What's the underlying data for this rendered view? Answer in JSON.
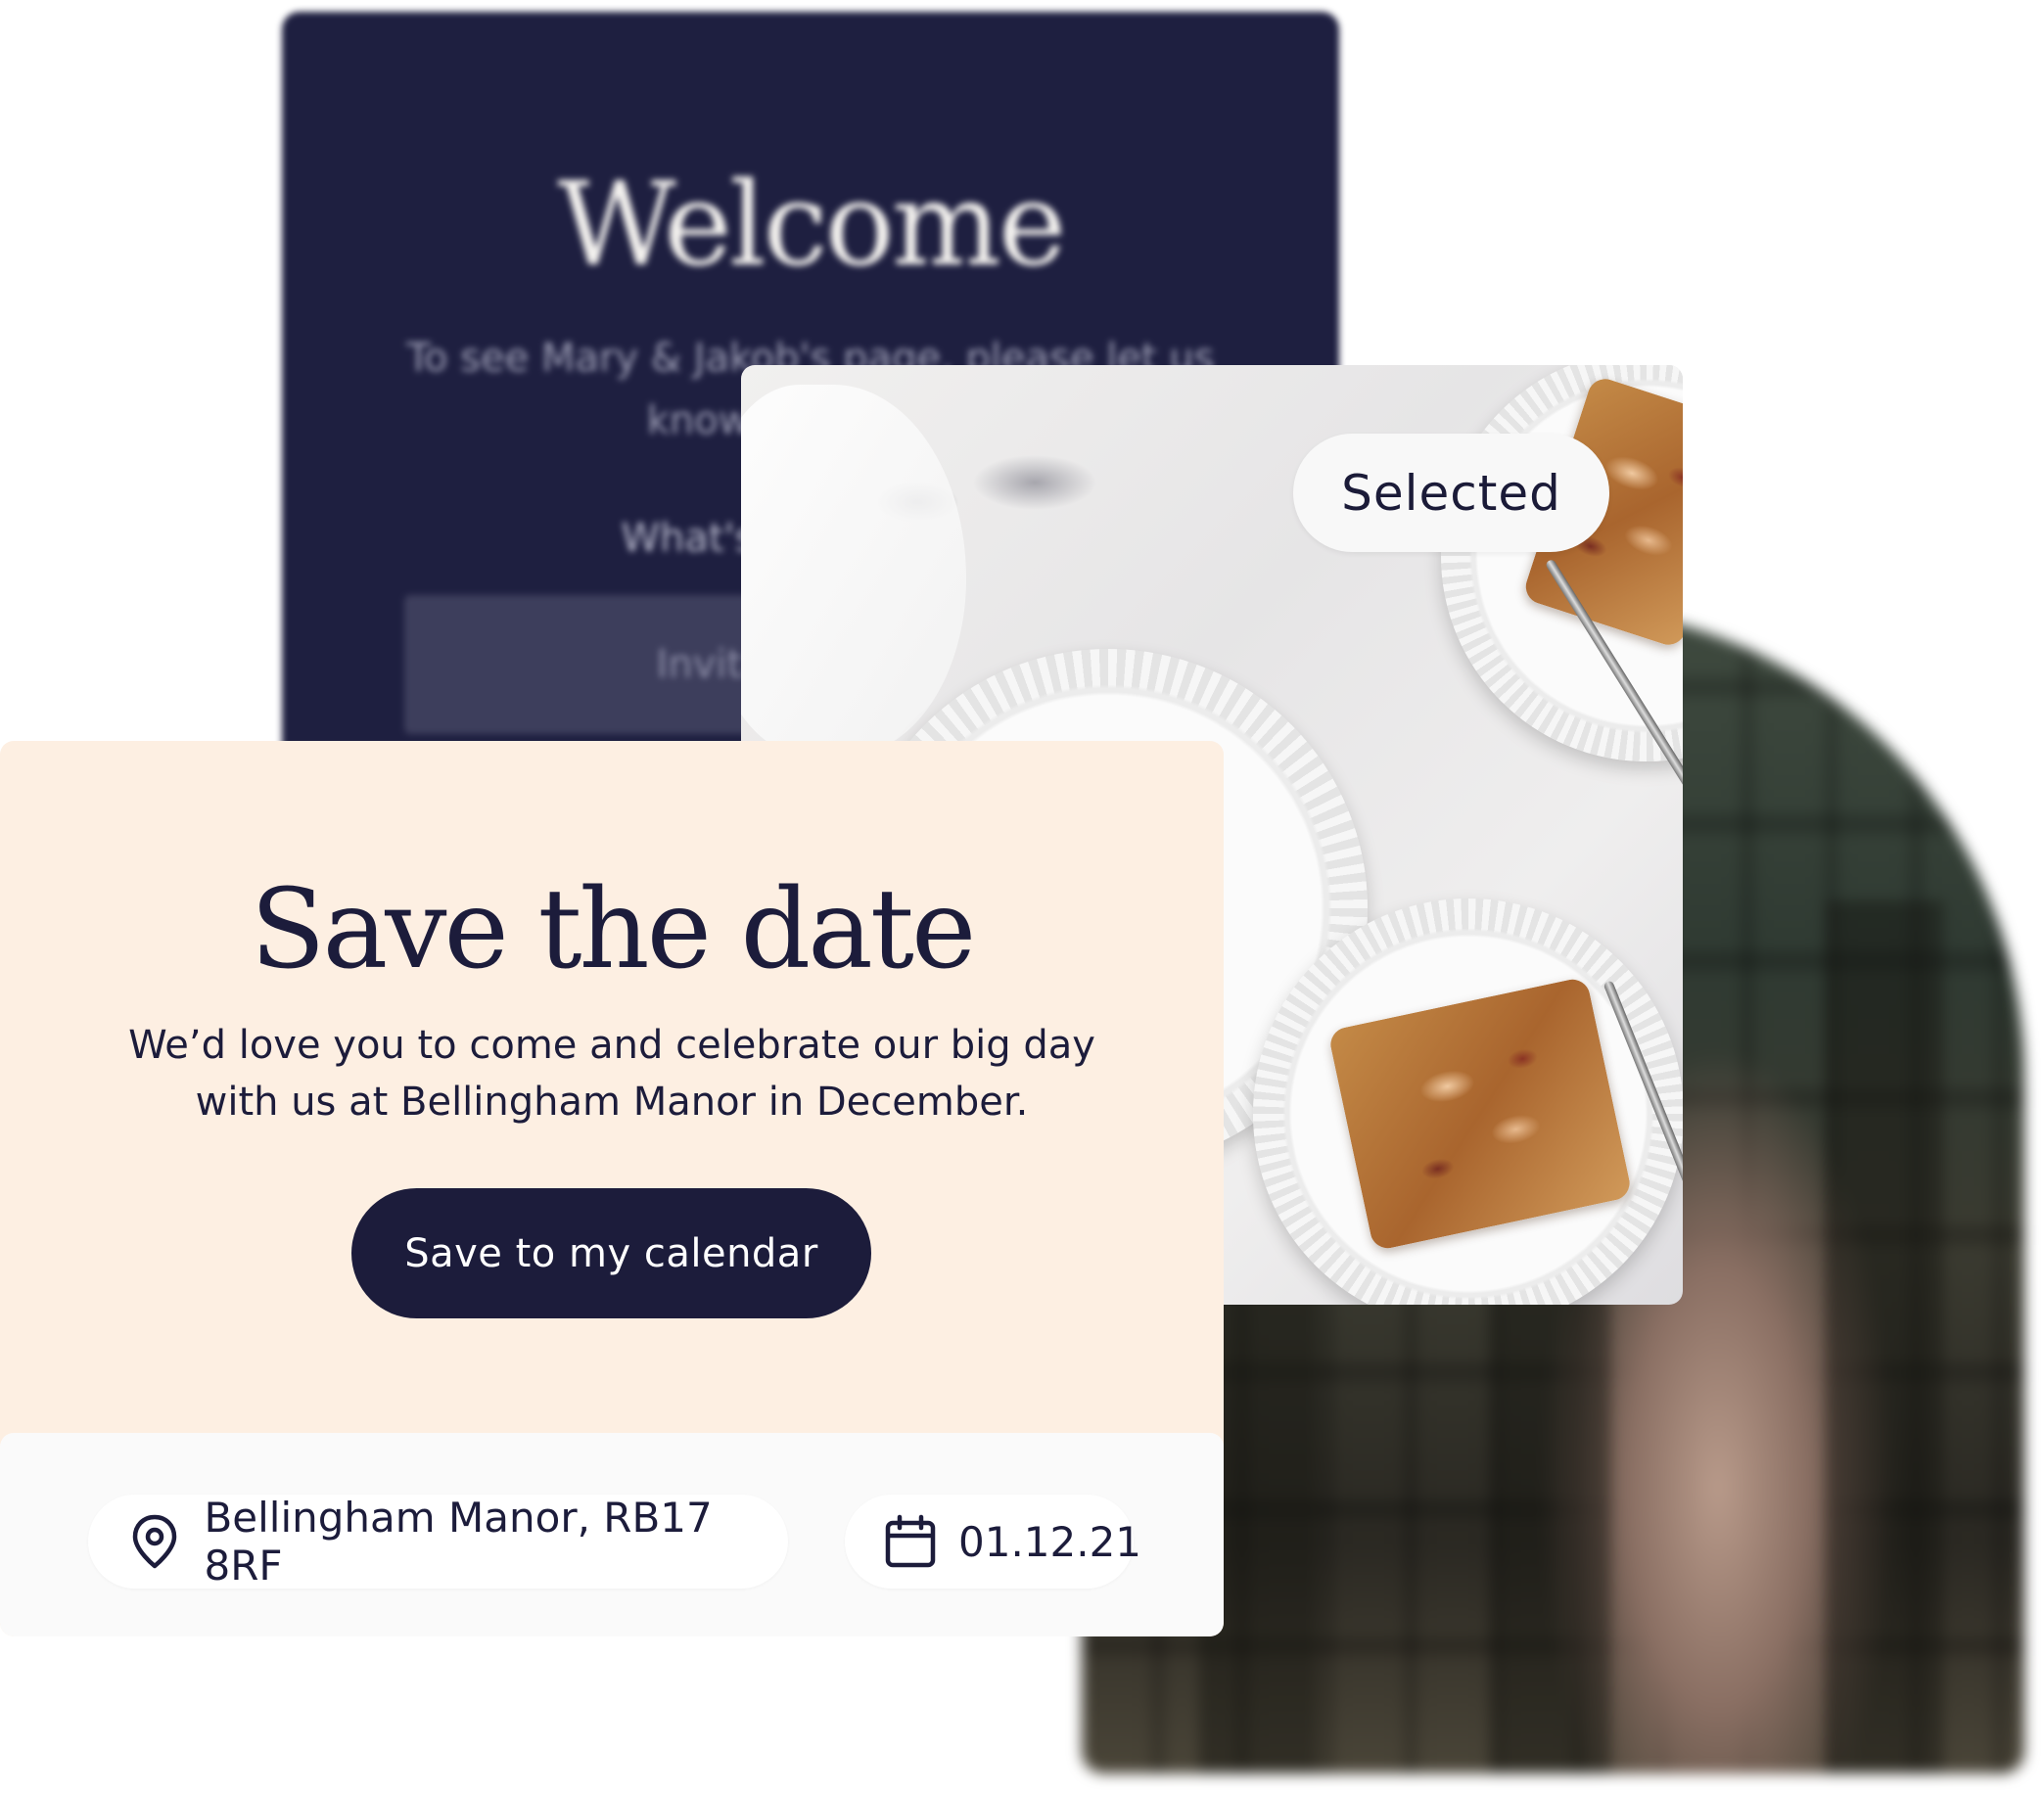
{
  "welcome_card": {
    "title": "Welcome",
    "body": "To see Mary & Jakob's page, please let us know your name",
    "question": "What's your name?",
    "input_placeholder": "Invitation name"
  },
  "photo_card": {
    "badge": "Selected"
  },
  "save_the_date": {
    "title": "Save the date",
    "body_line1": "We’d love you to come and celebrate our big day",
    "body_line2": "with us at Bellingham Manor in December.",
    "button_label": "Save to my calendar",
    "location": "Bellingham Manor, RB17 8RF",
    "date": "01.12.21",
    "icons": {
      "location": "map-pin-icon",
      "date": "calendar-icon"
    }
  },
  "colors": {
    "navy": "#1c1c3b",
    "cream": "#fdefe2",
    "footer": "#fafafa",
    "welcome_bg": "#1e1f40"
  }
}
